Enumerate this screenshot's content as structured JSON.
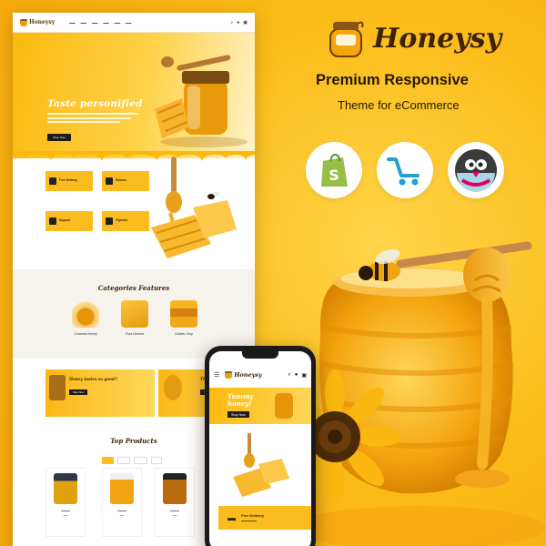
{
  "brand": {
    "name": "Honeysy",
    "tagline_line1": "Premium Responsive",
    "tagline_line2": "Theme for eCommerce"
  },
  "platform_badges": [
    {
      "icon": "shopify-icon",
      "color": "#95bf47"
    },
    {
      "icon": "opencart-icon",
      "color": "#23a1d1"
    },
    {
      "icon": "prestashop-icon",
      "color": "#df0067"
    }
  ],
  "colors": {
    "accent": "#fbbc1f",
    "dark": "#3b2304",
    "button": "#1f1a14"
  },
  "desktop": {
    "logo": "Honeysy",
    "hero": {
      "title": "Taste personified",
      "button": "Shop Now"
    },
    "features": [
      {
        "label": "Free Delivery"
      },
      {
        "label": "Returns"
      },
      {
        "label": "Support"
      },
      {
        "label": "Payment"
      }
    ],
    "categories": {
      "title": "Categories Features",
      "items": [
        {
          "label": "Creamed Honey"
        },
        {
          "label": "Pure Harvest"
        },
        {
          "label": "Golden Drop"
        }
      ]
    },
    "banners": [
      {
        "title": "Honey tastes so good!!",
        "button": "Shop Now"
      },
      {
        "title": "The Best Re",
        "button": "Shop Now"
      }
    ],
    "top_products": {
      "title": "Top Products"
    }
  },
  "phone": {
    "logo": "Honeysy",
    "hero_title_line1": "Yummy",
    "hero_title_line2": "honey!",
    "hero_button": "Shop Now",
    "delivery_title": "Free Delivery"
  }
}
